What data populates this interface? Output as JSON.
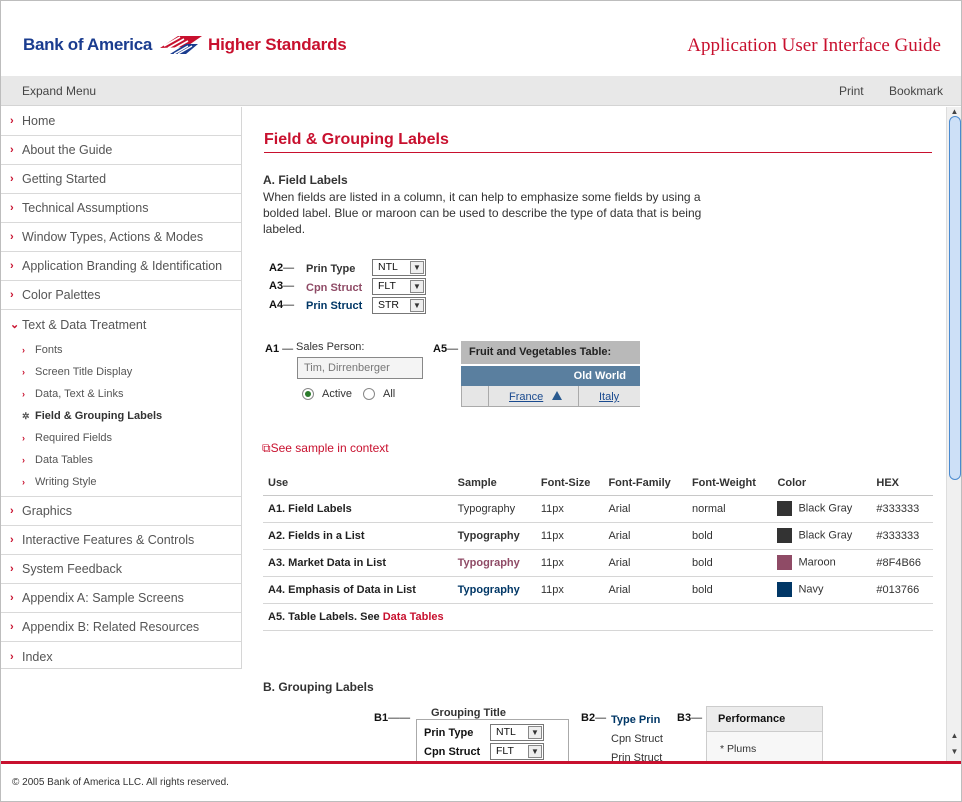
{
  "header": {
    "logo_bank": "Bank of America",
    "logo_tagline": "Higher Standards",
    "app_title": "Application User Interface Guide"
  },
  "toolbar": {
    "expand_label": "Expand Menu",
    "print_label": "Print",
    "bookmark_label": "Bookmark"
  },
  "sidebar": {
    "items": [
      {
        "label": "Home"
      },
      {
        "label": "About the Guide"
      },
      {
        "label": "Getting Started"
      },
      {
        "label": "Technical Assumptions"
      },
      {
        "label": "Window Types, Actions & Modes"
      },
      {
        "label": "Application Branding & Identification"
      },
      {
        "label": "Color Palettes"
      },
      {
        "label": "Text & Data Treatment"
      },
      {
        "label": "Graphics"
      },
      {
        "label": "Interactive Features & Controls"
      },
      {
        "label": "System Feedback"
      },
      {
        "label": "Appendix A: Sample Screens"
      },
      {
        "label": "Appendix B: Related Resources"
      },
      {
        "label": "Index"
      }
    ],
    "subitems": [
      {
        "label": "Fonts"
      },
      {
        "label": "Screen Title Display"
      },
      {
        "label": "Data, Text & Links"
      },
      {
        "label": "Field & Grouping Labels"
      },
      {
        "label": "Required Fields"
      },
      {
        "label": "Data Tables"
      },
      {
        "label": "Writing Style"
      }
    ]
  },
  "main": {
    "page_title": "Field & Grouping Labels",
    "section_a_title": "A. Field Labels",
    "section_a_body": "When fields are listed in a column, it can help to emphasize some fields by using a bolded label. Blue or maroon can be used to describe the type of data that is being labeled.",
    "examples": {
      "a2": {
        "tag": "A2",
        "label": "Prin Type",
        "value": "NTL",
        "color": "#333333"
      },
      "a3": {
        "tag": "A3",
        "label": "Cpn Struct",
        "value": "FLT",
        "color": "#8F4B66"
      },
      "a4": {
        "tag": "A4",
        "label": "Prin Struct",
        "value": "STR",
        "color": "#013766"
      },
      "a1": {
        "tag": "A1",
        "label": "Sales Person:",
        "value": "Tim, Dirrenberger",
        "radio_active": "Active",
        "radio_all": "All"
      },
      "a5": {
        "tag": "A5",
        "table_title": "Fruit and Vegetables Table:",
        "group": "Old World",
        "col1": "France",
        "col2": "Italy"
      }
    },
    "sample_link": "See sample in context",
    "table": {
      "headers": [
        "Use",
        "Sample",
        "Font-Size",
        "Font-Family",
        "Font-Weight",
        "Color",
        "HEX"
      ],
      "rows": [
        {
          "use": "A1. Field Labels",
          "sample": "Typography",
          "size": "11px",
          "family": "Arial",
          "weight": "normal",
          "color_name": "Black Gray",
          "hex": "#333333",
          "swatch": "#333333"
        },
        {
          "use": "A2. Fields in a List",
          "sample": "Typography",
          "size": "11px",
          "family": "Arial",
          "weight": "bold",
          "color_name": "Black Gray",
          "hex": "#333333",
          "swatch": "#333333"
        },
        {
          "use": "A3. Market Data in List",
          "sample": "Typography",
          "size": "11px",
          "family": "Arial",
          "weight": "bold",
          "color_name": "Maroon",
          "hex": "#8F4B66",
          "swatch": "#8F4B66"
        },
        {
          "use": "A4. Emphasis of Data in List",
          "sample": "Typography",
          "size": "11px",
          "family": "Arial",
          "weight": "bold",
          "color_name": "Navy",
          "hex": "#013766",
          "swatch": "#013766"
        }
      ],
      "last_row_prefix": "A5. Table Labels. See ",
      "last_row_link": "Data Tables"
    },
    "section_b_title": "B. Grouping Labels",
    "b1": {
      "tag": "B1",
      "group_title": "Grouping Title",
      "row1_label": "Prin Type",
      "row1_value": "NTL",
      "row2_label": "Cpn Struct",
      "row2_value": "FLT"
    },
    "b2": {
      "tag": "B2",
      "line1": "Type Prin",
      "line2": "Cpn Struct",
      "line3": "Prin Struct"
    },
    "b3": {
      "tag": "B3",
      "header": "Performance",
      "item": "Plums"
    }
  },
  "footer": {
    "copyright": "© 2005 Bank of America LLC. All rights reserved."
  },
  "colors": {
    "brand_red": "#c8102e",
    "navy": "#013766",
    "maroon": "#8F4B66",
    "table_blue": "#5a7f9f"
  }
}
